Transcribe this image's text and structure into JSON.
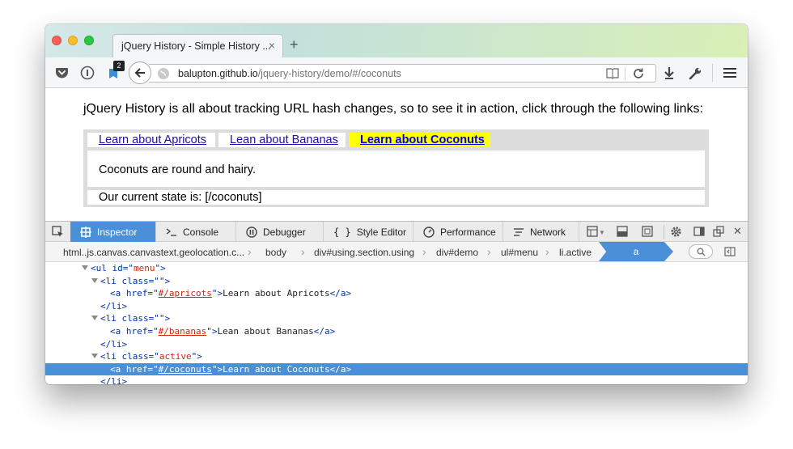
{
  "browser": {
    "tab_title": "jQuery History - Simple History ...",
    "tab_close": "×",
    "new_tab": "+",
    "badge_count": "2",
    "url_host": "balupton.github.io",
    "url_path": "/jquery-history/demo/#/coconuts"
  },
  "page": {
    "intro": "jQuery History is all about tracking URL hash changes, so to see it in action, click through the following links:",
    "menu": [
      {
        "label": "Learn about Apricots",
        "active": false
      },
      {
        "label": "Lean about Bananas",
        "active": false
      },
      {
        "label": "Learn about Coconuts",
        "active": true
      }
    ],
    "panel_text": "Coconuts are round and hairy.",
    "state_text": "Our current state is: [/coconuts]"
  },
  "devtools": {
    "tabs": [
      "Inspector",
      "Console",
      "Debugger",
      "Style Editor",
      "Performance",
      "Network"
    ],
    "active_tab": "Inspector",
    "accent_color": "#4a90d9",
    "breadcrumbs": [
      "html..js.canvas.canvastext.geolocation.c...",
      "body",
      "div#using.section.using",
      "div#demo",
      "ul#menu",
      "li.active"
    ],
    "breadcrumb_active": "a"
  },
  "markup": {
    "ul_tag": "ul",
    "id_attr": "id",
    "id_val": "menu",
    "li_tag": "li",
    "class_attr": "class",
    "class_empty": "",
    "class_active": "active",
    "a_tag": "a",
    "href_attr": "href",
    "links": [
      {
        "href": "#/apricots",
        "text": "Learn about Apricots"
      },
      {
        "href": "#/bananas",
        "text": "Lean about Bananas"
      },
      {
        "href": "#/coconuts",
        "text": "Learn about Coconuts"
      }
    ]
  }
}
